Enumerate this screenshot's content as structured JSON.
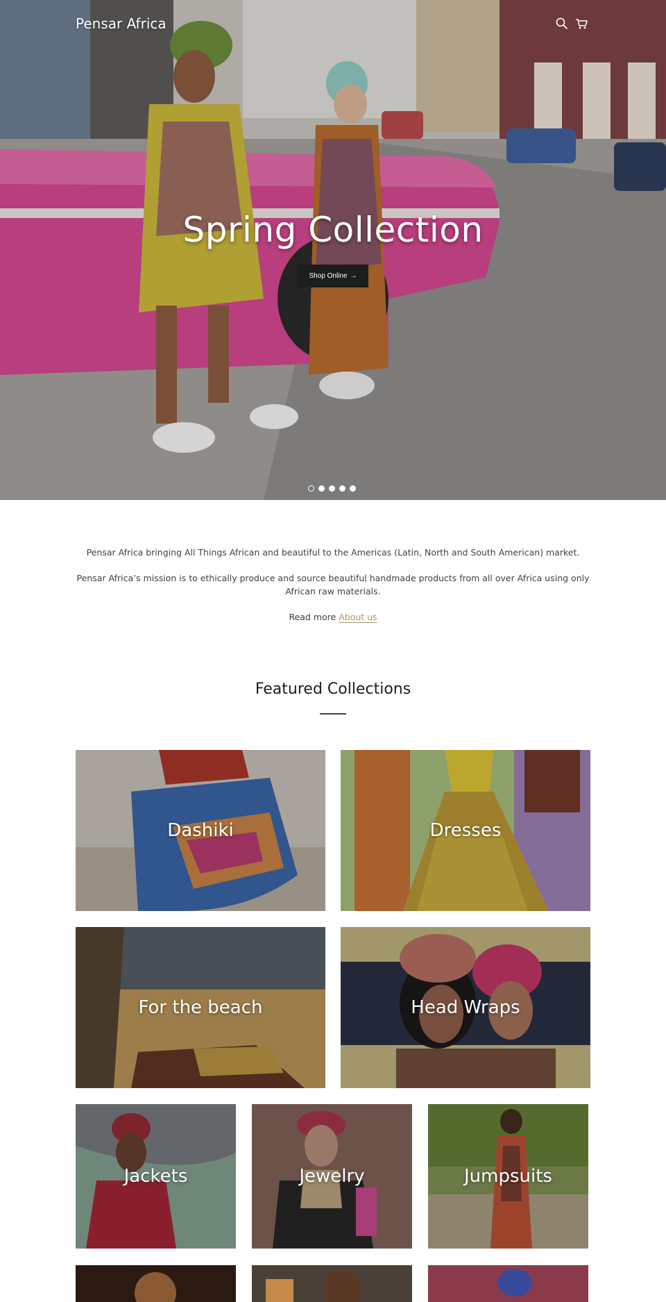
{
  "header": {
    "logo": "Pensar Africa",
    "search_icon": "search-icon",
    "cart_icon": "cart-icon"
  },
  "hero": {
    "title": "Spring Collection",
    "button_label": "Shop Online",
    "button_arrow": "→",
    "slides": 5,
    "active_slide": 1
  },
  "intro": {
    "line1": "Pensar Africa bringing All Things African and beautiful to the Americas (Latin, North and South American) market.",
    "line2": "Pensar Africa’s mission is to ethically produce and source beautiful handmade products from all over Africa using only African raw materials.",
    "read_more": "Read more ",
    "about_link": "About us"
  },
  "featured": {
    "title": "Featured Collections",
    "collections": [
      {
        "label": "Dashiki"
      },
      {
        "label": "Dresses"
      },
      {
        "label": "For the beach"
      },
      {
        "label": "Head Wraps"
      },
      {
        "label": "Jackets"
      },
      {
        "label": "Jewelry"
      },
      {
        "label": "Jumpsuits"
      }
    ]
  },
  "colors": {
    "accent_link": "#a8946a",
    "button_bg": "#1c1d1d",
    "text": "#3d4246"
  }
}
